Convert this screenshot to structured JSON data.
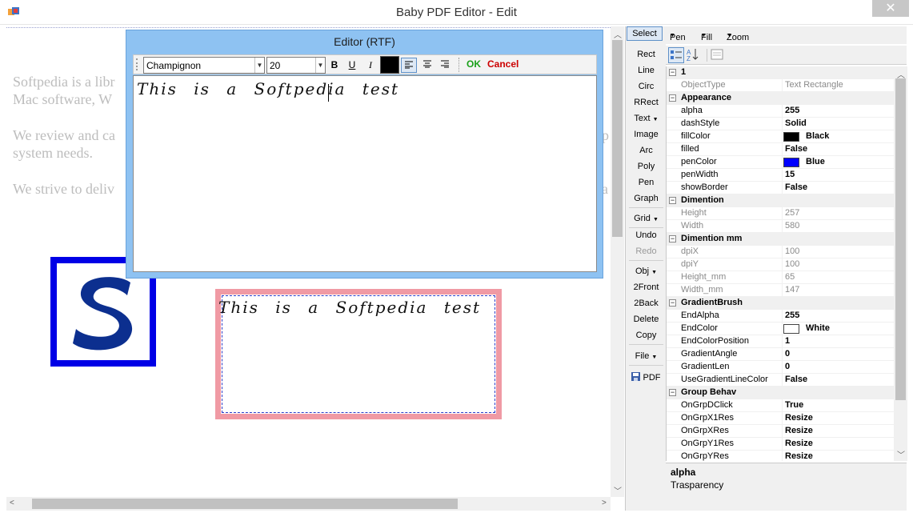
{
  "window": {
    "title": "Baby PDF Editor - Edit",
    "close_glyph": "✕"
  },
  "canvas": {
    "paragraphs": [
      "Softpedia is a libr",
      "Mac software, W",
      "We review and ca",
      "system needs.",
      "We strive to deliv"
    ],
    "right_fragments": [
      "p",
      "a"
    ],
    "text_rect_content": "This is a Softpedia test"
  },
  "editor": {
    "title": "Editor (RTF)",
    "font": "Champignon",
    "size": "20",
    "bold": "B",
    "underline": "U",
    "italic": "I",
    "text_color": "#000000",
    "ok": "OK",
    "cancel": "Cancel",
    "content": "This is a Softpedia test"
  },
  "tools": {
    "select": "Select",
    "items": [
      "Rect",
      "Line",
      "Circ",
      "RRect",
      "Text",
      "Image",
      "Arc",
      "Poly",
      "Pen",
      "Graph"
    ],
    "grid": "Grid",
    "undo": "Undo",
    "redo": "Redo",
    "obj": "Obj",
    "front": "2Front",
    "back": "2Back",
    "delete": "Delete",
    "copy": "Copy",
    "file": "File",
    "pdf": "PDF"
  },
  "panel_menu": {
    "pen": "Pen",
    "fill": "Fill",
    "zoom": "Zoom"
  },
  "properties": {
    "object_id": "1",
    "object_type_key": "ObjectType",
    "object_type_value": "Text Rectangle",
    "appearance": {
      "label": "Appearance",
      "rows": [
        {
          "k": "alpha",
          "v": "255"
        },
        {
          "k": "dashStyle",
          "v": "Solid"
        },
        {
          "k": "fillColor",
          "v": "Black",
          "color": "#000000"
        },
        {
          "k": "filled",
          "v": "False"
        },
        {
          "k": "penColor",
          "v": "Blue",
          "color": "#0000ff"
        },
        {
          "k": "penWidth",
          "v": "15"
        },
        {
          "k": "showBorder",
          "v": "False"
        }
      ]
    },
    "dimention": {
      "label": "Dimention",
      "rows": [
        {
          "k": "Height",
          "v": "257"
        },
        {
          "k": "Width",
          "v": "580"
        }
      ]
    },
    "dimention_mm": {
      "label": "Dimention mm",
      "rows": [
        {
          "k": "dpiX",
          "v": "100"
        },
        {
          "k": "dpiY",
          "v": "100"
        },
        {
          "k": "Height_mm",
          "v": "65"
        },
        {
          "k": "Width_mm",
          "v": "147"
        }
      ]
    },
    "gradient": {
      "label": "GradientBrush",
      "rows": [
        {
          "k": "EndAlpha",
          "v": "255"
        },
        {
          "k": "EndColor",
          "v": "White",
          "color": "#ffffff"
        },
        {
          "k": "EndColorPosition",
          "v": "1"
        },
        {
          "k": "GradientAngle",
          "v": "0"
        },
        {
          "k": "GradientLen",
          "v": "0"
        },
        {
          "k": "UseGradientLineColor",
          "v": "False"
        }
      ]
    },
    "group": {
      "label": "Group Behav",
      "rows": [
        {
          "k": "OnGrpDClick",
          "v": "True"
        },
        {
          "k": "OnGrpX1Res",
          "v": "Resize"
        },
        {
          "k": "OnGrpXRes",
          "v": "Resize"
        },
        {
          "k": "OnGrpY1Res",
          "v": "Resize"
        },
        {
          "k": "OnGrpYRes",
          "v": "Resize"
        }
      ]
    }
  },
  "description": {
    "title": "alpha",
    "text": "Trasparency"
  }
}
